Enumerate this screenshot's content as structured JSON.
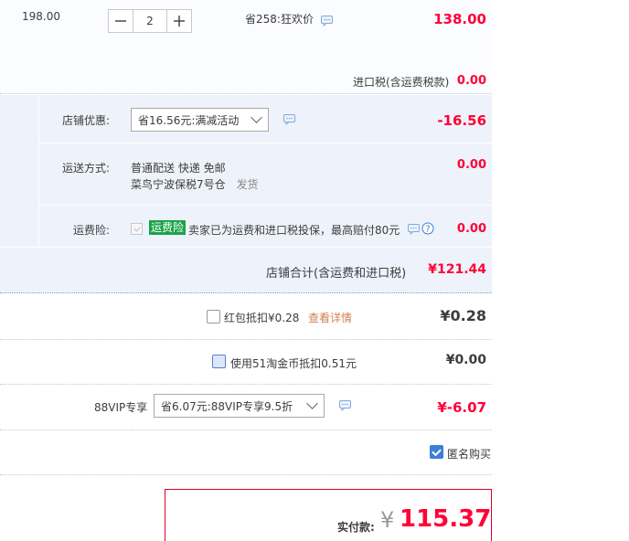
{
  "item": {
    "unit_price": "198.00",
    "quantity": "2",
    "discount": "省258:狂欢价",
    "subtotal": "138.00",
    "import_tax_label": "进口税(含运费税款)",
    "import_tax_value": "0.00"
  },
  "shop": {
    "promo_label": "店铺优惠:",
    "promo_select": "省16.56元:满减活动",
    "promo_value": "-16.56",
    "shipping_label": "运送方式:",
    "shipping_line1": "普通配送 快递 免邮",
    "shipping_warehouse": "菜鸟宁波保税7号仓",
    "shipping_dispatch": "发货",
    "shipping_value": "0.00",
    "insurance_label": "运费险:",
    "insurance_badge": "运费险",
    "insurance_text": "卖家已为运费和进口税投保，最高赔付80元",
    "insurance_value": "0.00",
    "total_label": "店铺合计(含运费和进口税)",
    "total_value": "¥121.44"
  },
  "redpacket": {
    "label": "红包抵扣¥0.28",
    "link": "查看详情",
    "value": "¥0.28"
  },
  "taojinbi": {
    "label": "使用51淘金币抵扣0.51元",
    "value": "¥0.00"
  },
  "vip": {
    "label": "88VIP专享",
    "select": "省6.07元:88VIP专享9.5折",
    "value": "¥-6.07"
  },
  "anonymous": {
    "label": "匿名购买"
  },
  "payment": {
    "label": "实付款:",
    "currency": "¥",
    "amount": "115.37"
  },
  "colors": {
    "accent_red": "#ff0036",
    "link_orange": "#d37f4f",
    "badge_green": "#1aa34a",
    "panel_blue": "#eef3fb"
  },
  "icons": [
    "minus-icon",
    "plus-icon",
    "message-icon",
    "help-icon",
    "chevron-down-icon",
    "checkmark-icon"
  ]
}
